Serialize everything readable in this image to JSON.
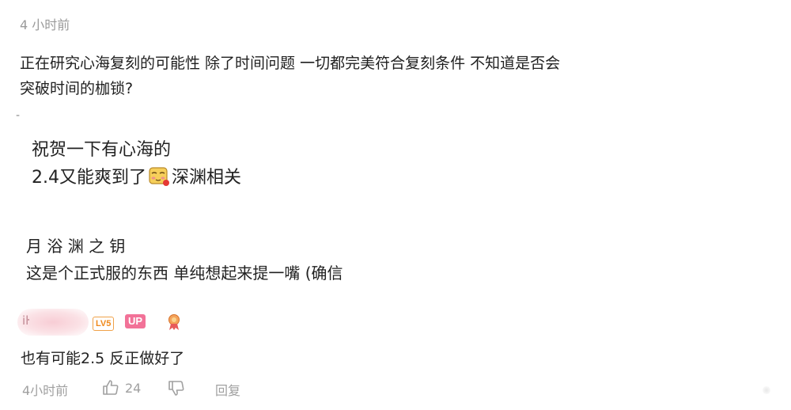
{
  "comment": {
    "timestamp": "4 小时前",
    "line1": "正在研究心海复刻的可能性 除了时间问题 一切都完美符合复刻条件 不知道是否会",
    "line2": "突破时间的枷锁?",
    "separator": "-"
  },
  "reply_quote": {
    "line1": "祝贺一下有心海的",
    "line2_before": "2.4又能爽到了",
    "sticker_icon": "yellow-cheek-emoji",
    "line2_after": "深渊相关"
  },
  "reply_post": {
    "username": "月 浴 渊 之 钥",
    "text": "这是个正式服的东西 单纯想起来提一嘴 (确信"
  },
  "reply_user": {
    "name_fragment": "iŀ",
    "level_badge": "LV5",
    "up_badge": "UP",
    "medal_icon": "medal-icon",
    "accent_up": "#f27298",
    "accent_level": "#f08a1c"
  },
  "reply_text": "也有可能2.5 反正做好了",
  "actions": {
    "time": "4小时前",
    "like_count": "24",
    "reply_label": "回复"
  }
}
